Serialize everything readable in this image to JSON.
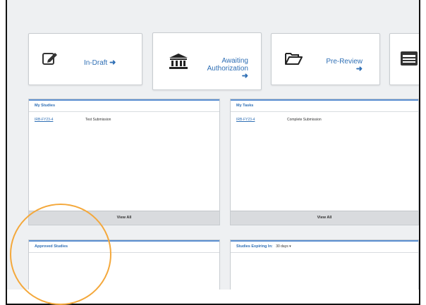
{
  "tiles": [
    {
      "icon": "edit-icon",
      "label_lines": [
        "In-Draft"
      ]
    },
    {
      "icon": "bank-icon",
      "label_lines": [
        "Awaiting",
        "Authorization"
      ]
    },
    {
      "icon": "folder-open-icon",
      "label_lines": [
        "Pre-Review"
      ]
    },
    {
      "icon": "window-list-icon",
      "label_lines": []
    }
  ],
  "panels": {
    "my_studies": {
      "title": "My Studies",
      "rows": [
        {
          "id": "IRB-FY23-4",
          "name": "Test Submission"
        }
      ],
      "footer": "View All"
    },
    "my_tasks": {
      "title": "My Tasks",
      "rows": [
        {
          "id": "IRB-FY23-4",
          "name": "Complete Submission"
        }
      ],
      "footer": "View All"
    },
    "approved_studies": {
      "title": "Approved Studies"
    },
    "studies_expiring": {
      "title": "Studies Expiring In:",
      "select_value": "30 days"
    }
  },
  "colors": {
    "accent": "#2f6fb5",
    "highlight_circle": "#f4a83b",
    "panel_header_rule": "#5b8fd1"
  }
}
